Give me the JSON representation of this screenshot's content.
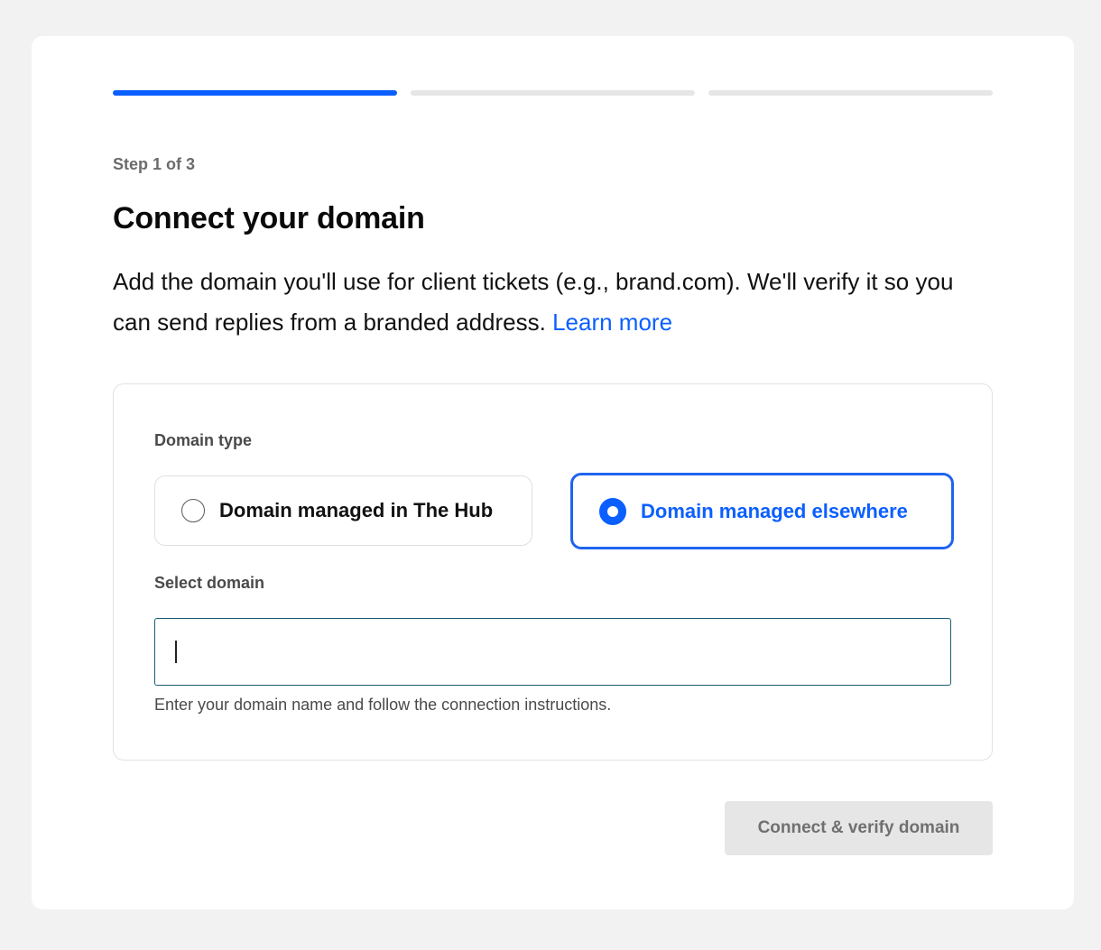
{
  "progress": {
    "total_steps": 3,
    "current_step": 1
  },
  "step_label": "Step 1 of 3",
  "title": "Connect your domain",
  "description": {
    "text": "Add the domain you'll use for client tickets (e.g., brand.com). We'll verify it so you can send replies from a branded address.",
    "link_label": "Learn more"
  },
  "domain_type": {
    "label": "Domain type",
    "options": [
      {
        "label": "Domain managed in The Hub",
        "selected": false
      },
      {
        "label": "Domain managed elsewhere",
        "selected": true
      }
    ]
  },
  "select_domain": {
    "label": "Select domain",
    "value": "",
    "placeholder": "",
    "helper": "Enter your domain name and follow the connection instructions."
  },
  "submit": {
    "label": "Connect & verify domain",
    "disabled": true
  },
  "colors": {
    "accent": "#0b5fff",
    "page_background": "#f2f2f2",
    "disabled_button": "#e6e6e6"
  }
}
